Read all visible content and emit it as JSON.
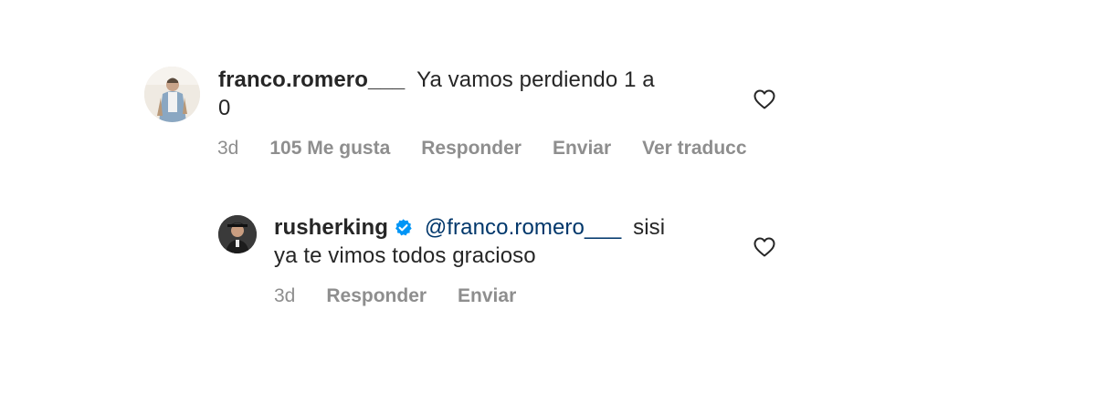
{
  "comments": [
    {
      "username": "franco.romero___",
      "text_line1": "Ya vamos perdiendo 1 a",
      "text_line2": "0",
      "time": "3d",
      "likes": "105 Me gusta",
      "reply": "Responder",
      "send": "Enviar",
      "translate": "Ver traducc",
      "icon": "heart-outline-icon"
    },
    {
      "username": "rusherking",
      "verified": true,
      "mention": "@franco.romero___",
      "text_line1": "sisi",
      "text_line2": "ya te vimos todos gracioso",
      "time": "3d",
      "reply": "Responder",
      "send": "Enviar",
      "icon": "heart-outline-icon"
    }
  ],
  "colors": {
    "text": "#262626",
    "meta": "#8e8e8e",
    "mention": "#00376b",
    "verified": "#0095f6"
  }
}
